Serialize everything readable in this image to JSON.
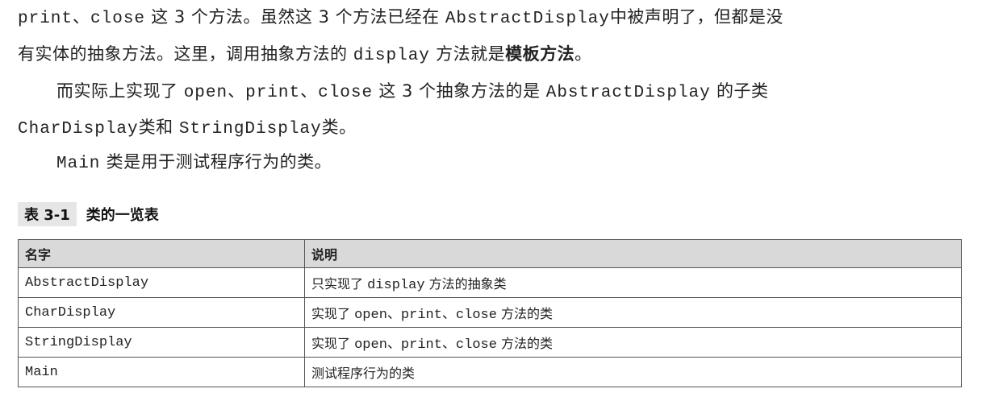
{
  "paragraph": {
    "line1": {
      "a": "print、close",
      "b": "这 3 个方法。虽然这 3 个方法已经在",
      "c": "AbstractDisplay",
      "d": "中被声明了，但都是没"
    },
    "line2": {
      "a": "有实体的抽象方法。这里，调用抽象方法的",
      "b": "display",
      "c": "方法就是",
      "d": "模板方法",
      "e": "。"
    },
    "line3": {
      "a": "而实际上实现了",
      "b": "open、print、close",
      "c": "这 3 个抽象方法的是",
      "d": "AbstractDisplay",
      "e": "的子类"
    },
    "line4": {
      "a": "CharDisplay",
      "b": "类和",
      "c": "StringDisplay",
      "d": "类。"
    },
    "line5": {
      "a": "Main",
      "b": "类是用于测试程序行为的类。"
    }
  },
  "table_caption": {
    "number": "表 3-1",
    "title": "类的一览表"
  },
  "table": {
    "headers": [
      "名字",
      "说明"
    ],
    "rows": [
      {
        "name": "AbstractDisplay",
        "d1": "只实现了",
        "d2": "display",
        "d3": "方法的抽象类"
      },
      {
        "name": "CharDisplay",
        "d1": "实现了",
        "d2": "open、print、close",
        "d3": "方法的类"
      },
      {
        "name": "StringDisplay",
        "d1": "实现了",
        "d2": "open、print、close",
        "d3": "方法的类"
      },
      {
        "name": "Main",
        "d1": "测试程序行为的类",
        "d2": "",
        "d3": ""
      }
    ]
  }
}
